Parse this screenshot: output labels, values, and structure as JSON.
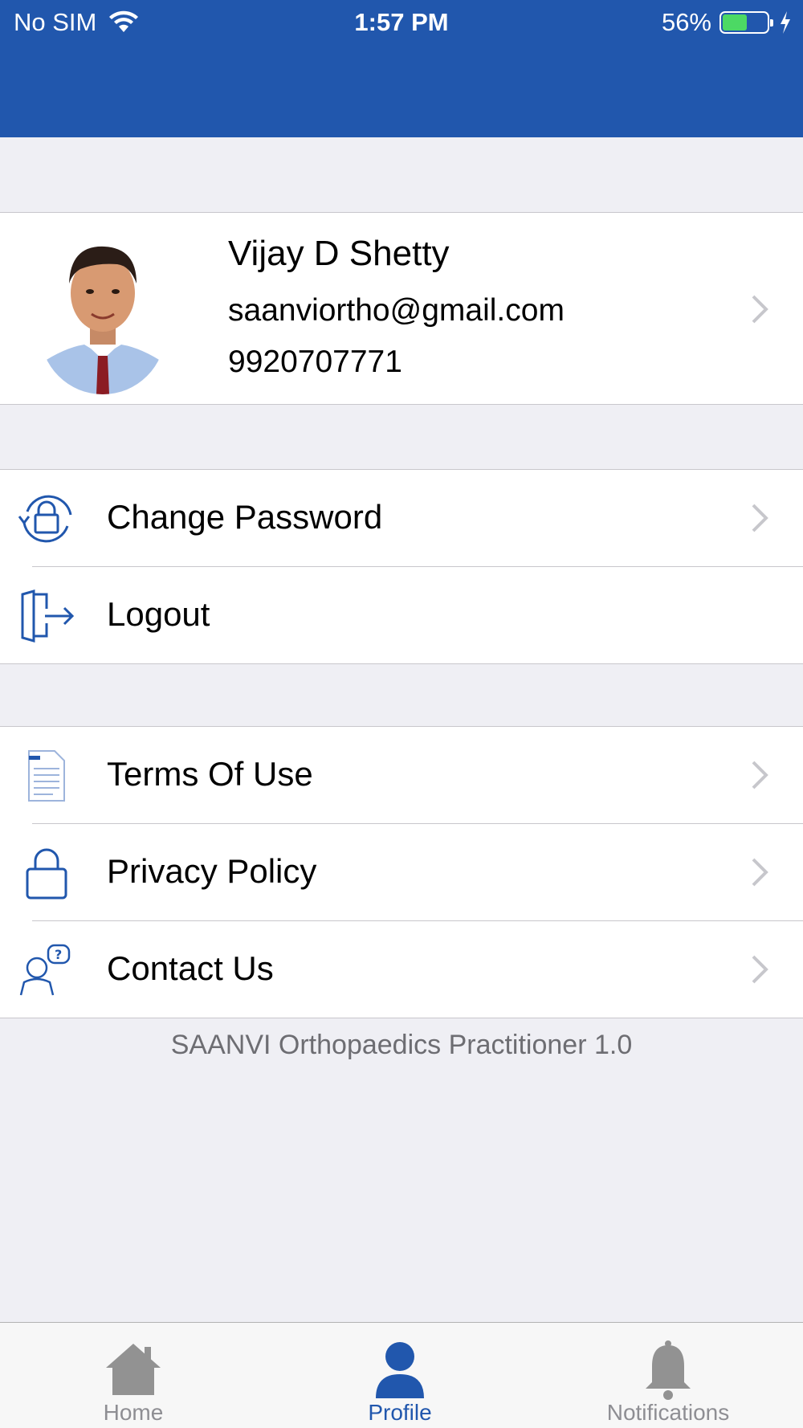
{
  "status_bar": {
    "carrier": "No SIM",
    "time": "1:57 PM",
    "battery": "56%",
    "battery_level": 0.56
  },
  "profile": {
    "name": "Vijay D Shetty",
    "email": "saanviortho@gmail.com",
    "phone": "9920707771"
  },
  "account_menu": [
    {
      "label": "Change Password",
      "icon": "lock-refresh-icon"
    },
    {
      "label": "Logout",
      "icon": "logout-door-icon"
    }
  ],
  "info_menu": [
    {
      "label": "Terms Of Use",
      "icon": "document-icon"
    },
    {
      "label": "Privacy Policy",
      "icon": "padlock-icon"
    },
    {
      "label": "Contact Us",
      "icon": "support-person-icon"
    }
  ],
  "footer": {
    "version_text": "SAANVI Orthopaedics Practitioner 1.0"
  },
  "tab_bar": {
    "tabs": [
      {
        "label": "Home",
        "icon": "home-icon",
        "active": false
      },
      {
        "label": "Profile",
        "icon": "person-icon",
        "active": true
      },
      {
        "label": "Notifications",
        "icon": "bell-icon",
        "active": false
      }
    ]
  },
  "colors": {
    "brand": "#2157ad",
    "background": "#efeff4",
    "inactive_tab": "#8e8e93"
  }
}
